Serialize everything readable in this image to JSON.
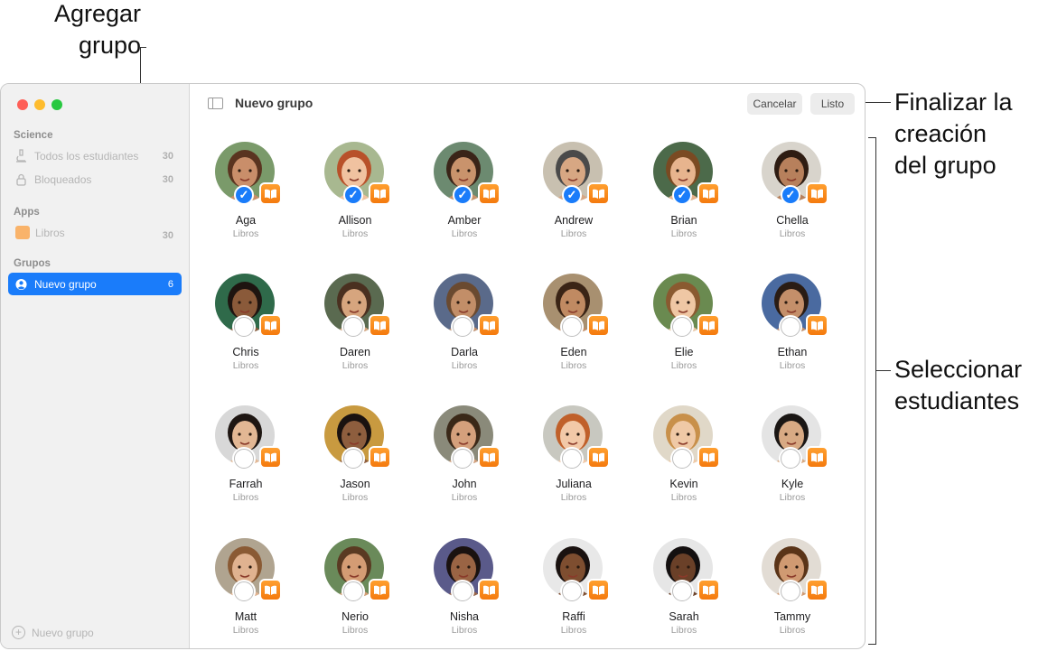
{
  "callouts": {
    "add_group": "Agregar\ngrupo",
    "finish": "Finalizar la\ncreación\ndel grupo",
    "select": "Seleccionar\nestudiantes"
  },
  "sidebar": {
    "sections": [
      {
        "title": "Science",
        "items": [
          {
            "label": "Todos los estudiantes",
            "count": "30",
            "icon": "microscope-icon"
          },
          {
            "label": "Bloqueados",
            "count": "30",
            "icon": "lock-icon"
          }
        ]
      },
      {
        "title": "Apps",
        "items": [
          {
            "label": "Libros",
            "count": "30",
            "icon": "books-app-icon"
          }
        ]
      },
      {
        "title": "Grupos",
        "items": [
          {
            "label": "Nuevo grupo",
            "count": "6",
            "icon": "person-circle-icon",
            "selected": true
          }
        ]
      }
    ],
    "add_label": "Nuevo grupo"
  },
  "toolbar": {
    "title": "Nuevo grupo",
    "cancel_label": "Cancelar",
    "done_label": "Listo"
  },
  "students": [
    {
      "name": "Aga",
      "app": "Libros",
      "selected": true,
      "skin": "#c98e6a",
      "hair": "#5a3420",
      "bg": "#7a9a6a"
    },
    {
      "name": "Allison",
      "app": "Libros",
      "selected": true,
      "skin": "#f0c2a0",
      "hair": "#b8512a",
      "bg": "#a8b890"
    },
    {
      "name": "Amber",
      "app": "Libros",
      "selected": true,
      "skin": "#c9936c",
      "hair": "#3a2418",
      "bg": "#6c8a70"
    },
    {
      "name": "Andrew",
      "app": "Libros",
      "selected": true,
      "skin": "#d7a783",
      "hair": "#4a4a4a",
      "bg": "#c8c0b0"
    },
    {
      "name": "Brian",
      "app": "Libros",
      "selected": true,
      "skin": "#e7b48e",
      "hair": "#7a4a22",
      "bg": "#4c6a4a"
    },
    {
      "name": "Chella",
      "app": "Libros",
      "selected": true,
      "skin": "#b7805c",
      "hair": "#2e1c12",
      "bg": "#d8d4cc"
    },
    {
      "name": "Chris",
      "app": "Libros",
      "selected": false,
      "skin": "#8a5a3a",
      "hair": "#1e1410",
      "bg": "#2f6a4a"
    },
    {
      "name": "Daren",
      "app": "Libros",
      "selected": false,
      "skin": "#d6a57e",
      "hair": "#4a3020",
      "bg": "#5a6a50"
    },
    {
      "name": "Darla",
      "app": "Libros",
      "selected": false,
      "skin": "#c28e68",
      "hair": "#6a4a30",
      "bg": "#5a6a8a"
    },
    {
      "name": "Eden",
      "app": "Libros",
      "selected": false,
      "skin": "#c08a62",
      "hair": "#3a2416",
      "bg": "#a89070"
    },
    {
      "name": "Elie",
      "app": "Libros",
      "selected": false,
      "skin": "#efc7a4",
      "hair": "#8a5a30",
      "bg": "#6a8a50"
    },
    {
      "name": "Ethan",
      "app": "Libros",
      "selected": false,
      "skin": "#c48f6a",
      "hair": "#2a1c14",
      "bg": "#4a6aa0"
    },
    {
      "name": "Farrah",
      "app": "Libros",
      "selected": false,
      "skin": "#e2b794",
      "hair": "#1e1612",
      "bg": "#d8d8d8"
    },
    {
      "name": "Jason",
      "app": "Libros",
      "selected": false,
      "skin": "#8e5e3e",
      "hair": "#1a1210",
      "bg": "#c89a40"
    },
    {
      "name": "John",
      "app": "Libros",
      "selected": false,
      "skin": "#d4a07c",
      "hair": "#3a2818",
      "bg": "#8a8a7a"
    },
    {
      "name": "Juliana",
      "app": "Libros",
      "selected": false,
      "skin": "#f2c9a8",
      "hair": "#c0602a",
      "bg": "#c8c8c0"
    },
    {
      "name": "Kevin",
      "app": "Libros",
      "selected": false,
      "skin": "#efc9a6",
      "hair": "#c8904a",
      "bg": "#e0d8c8"
    },
    {
      "name": "Kyle",
      "app": "Libros",
      "selected": false,
      "skin": "#d8aa84",
      "hair": "#1a1614",
      "bg": "#e4e4e4"
    },
    {
      "name": "Matt",
      "app": "Libros",
      "selected": false,
      "skin": "#e0b290",
      "hair": "#8a5a34",
      "bg": "#b0a490"
    },
    {
      "name": "Nerio",
      "app": "Libros",
      "selected": false,
      "skin": "#d49c74",
      "hair": "#5a3a22",
      "bg": "#6a8a5a"
    },
    {
      "name": "Nisha",
      "app": "Libros",
      "selected": false,
      "skin": "#9a6444",
      "hair": "#1a1210",
      "bg": "#5a5a8a"
    },
    {
      "name": "Raffi",
      "app": "Libros",
      "selected": false,
      "skin": "#7e4e30",
      "hair": "#1a1210",
      "bg": "#e8e8e8"
    },
    {
      "name": "Sarah",
      "app": "Libros",
      "selected": false,
      "skin": "#6a4028",
      "hair": "#141010",
      "bg": "#e6e6e6"
    },
    {
      "name": "Tammy",
      "app": "Libros",
      "selected": false,
      "skin": "#d09a72",
      "hair": "#5a3418",
      "bg": "#e2dcd4"
    }
  ]
}
